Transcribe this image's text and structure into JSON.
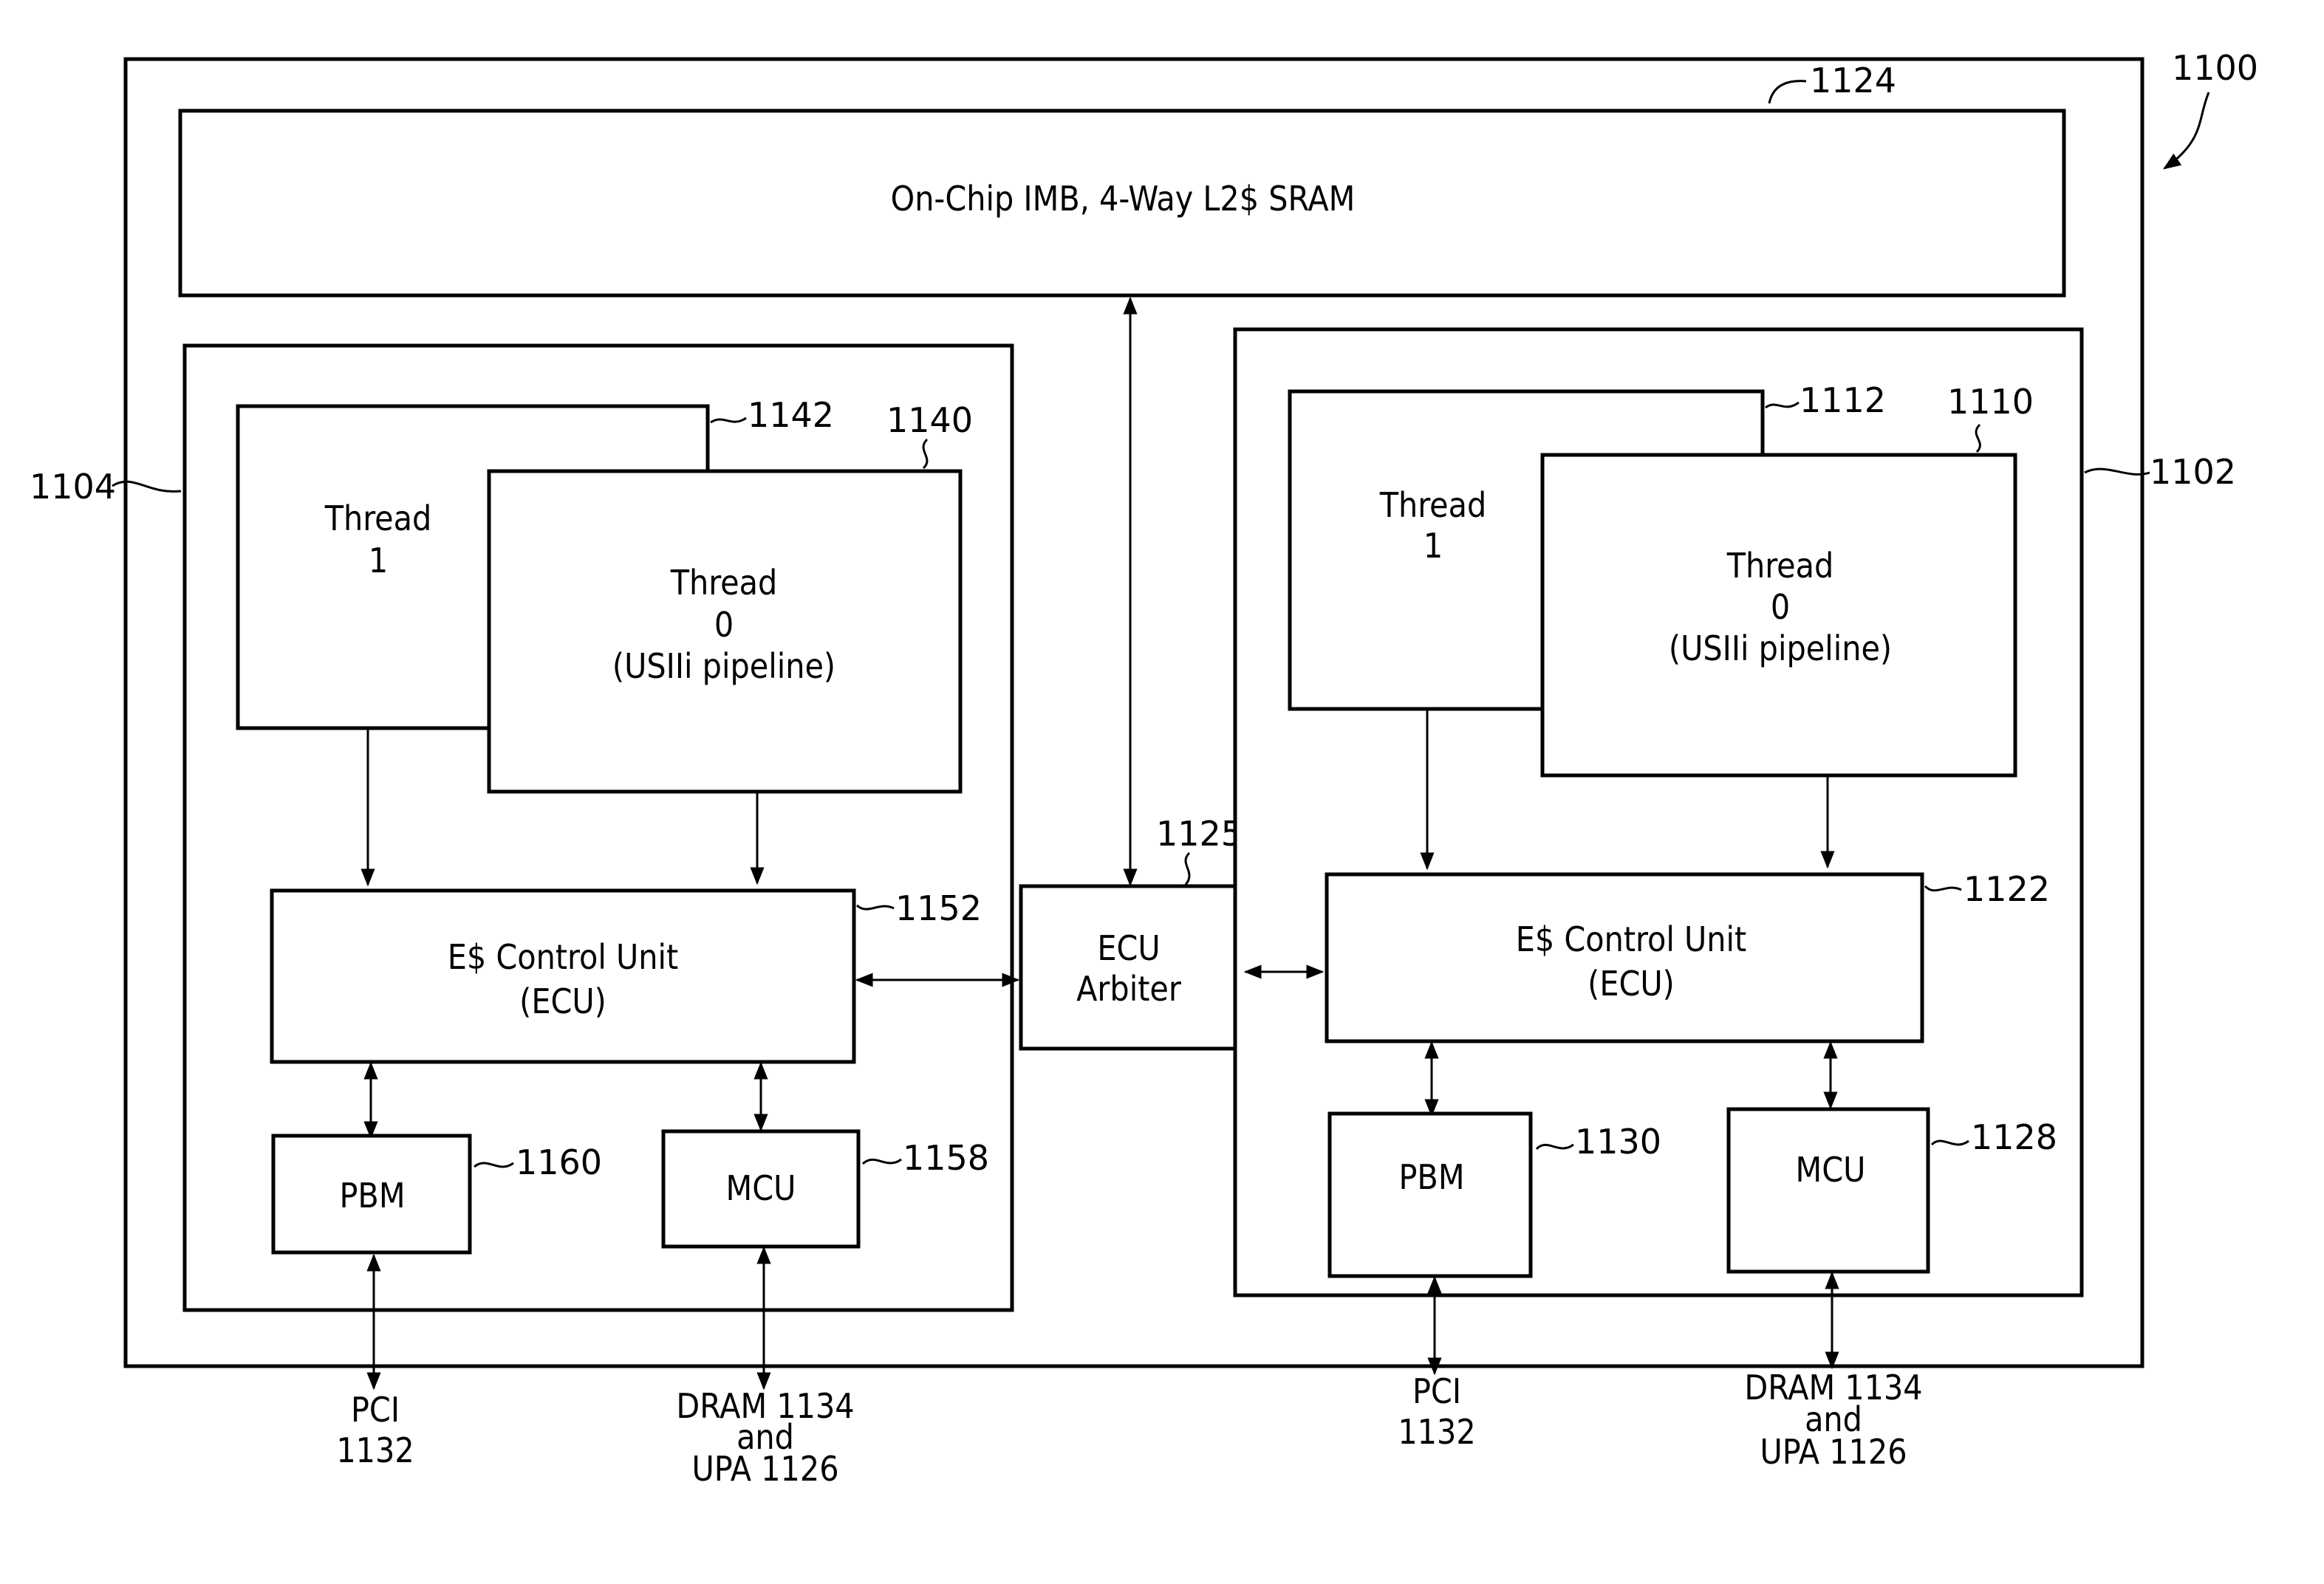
{
  "figure_ref": "1100",
  "chip": {
    "ref": "1100",
    "l2_sram": {
      "label": "On-Chip IMB, 4-Way L2$ SRAM",
      "ref": "1124"
    },
    "arbiter": {
      "line1": "ECU",
      "line2": "Arbiter",
      "ref": "1125"
    },
    "core_left": {
      "ref": "1104",
      "thread1": {
        "line1": "Thread",
        "line2": "1",
        "ref": "1142"
      },
      "thread0": {
        "line1": "Thread",
        "line2": "0",
        "line3": "(USIIi  pipeline)",
        "ref": "1140"
      },
      "ecu": {
        "line1": "E$ Control Unit",
        "line2": "(ECU)",
        "ref": "1152"
      },
      "pbm": {
        "label": "PBM",
        "ref": "1160"
      },
      "mcu": {
        "label": "MCU",
        "ref": "1158"
      },
      "pci": {
        "line1": "PCI",
        "line2": "1132"
      },
      "dram": {
        "line1": "DRAM 1134",
        "line2": "and",
        "line3": "UPA 1126"
      }
    },
    "core_right": {
      "ref": "1102",
      "thread1": {
        "line1": "Thread",
        "line2": "1",
        "ref": "1112"
      },
      "thread0": {
        "line1": "Thread",
        "line2": "0",
        "line3": "(USIIi  pipeline)",
        "ref": "1110"
      },
      "ecu": {
        "line1": "E$ Control Unit",
        "line2": "(ECU)",
        "ref": "1122"
      },
      "pbm": {
        "label": "PBM",
        "ref": "1130"
      },
      "mcu": {
        "label": "MCU",
        "ref": "1128"
      },
      "pci": {
        "line1": "PCI",
        "line2": "1132"
      },
      "dram": {
        "line1": "DRAM 1134",
        "line2": "and",
        "line3": "UPA 1126"
      }
    }
  }
}
